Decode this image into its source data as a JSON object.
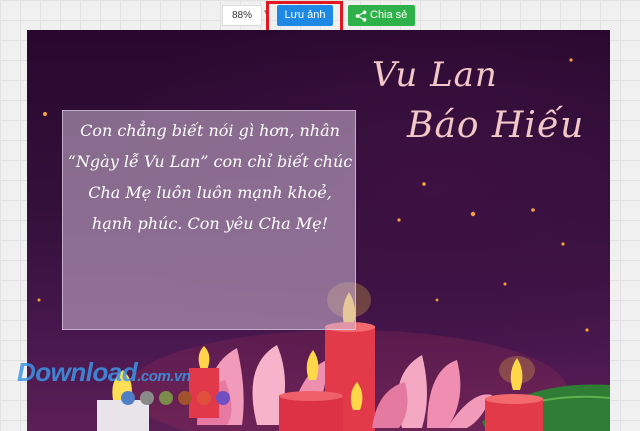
{
  "toolbar": {
    "zoom_value": "88%",
    "zoom_chevron": "▾",
    "save_label": "Lưu ảnh",
    "share_label": "Chia sẻ",
    "share_icon": "share-icon",
    "highlight_color": "#e0181f",
    "save_color": "#1e88e5",
    "share_color": "#2fb14a"
  },
  "card": {
    "title_line1": "Vu Lan",
    "title_line2": "Báo Hiếu",
    "message_lines": [
      "Con chẳng biết nói gì hơn, nhân",
      "“Ngày lễ Vu Lan” con chỉ biết chúc",
      "Cha Mẹ luôn luôn mạnh khoẻ,",
      "hạnh phúc. Con yêu Cha Mẹ!"
    ]
  },
  "watermark": {
    "main": "Download",
    "suffix": ".com.vn"
  },
  "swatches": [
    "#4f7fc6",
    "#8a8a8a",
    "#7b8b4a",
    "#a0522d",
    "#e0513d",
    "#6f4fc2"
  ]
}
